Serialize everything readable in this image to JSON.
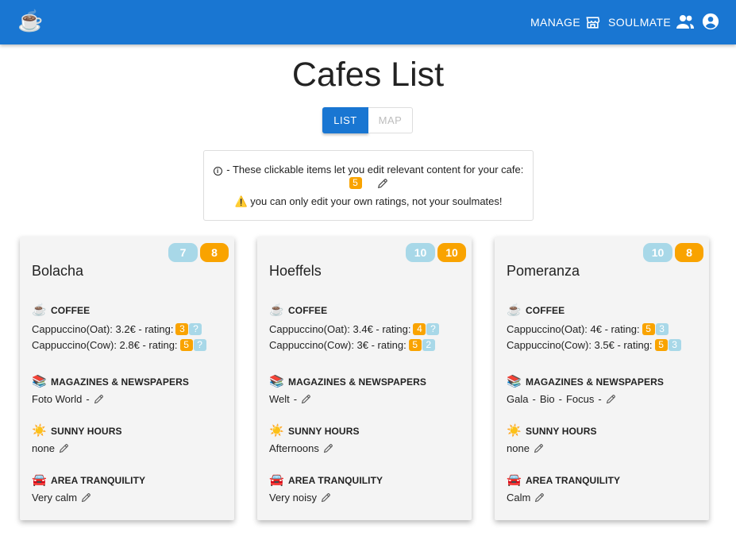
{
  "app": {
    "logo": "☕",
    "nav": {
      "manage": "MANAGE",
      "soulmate": "SOULMATE"
    }
  },
  "page": {
    "title": "Cafes List",
    "toggle": {
      "list": "LIST",
      "map": "MAP",
      "selected": "LIST"
    }
  },
  "info": {
    "line1": "- These clickable items let you edit relevant content for your cafe:",
    "example_badge": "5",
    "line3": "⚠️ you can only edit your own ratings, not your soulmates!"
  },
  "labels": {
    "coffee": "COFFEE",
    "magazines": "MAGAZINES & NEWSPAPERS",
    "sunny": "SUNNY HOURS",
    "tranquility": "AREA TRANQUILITY"
  },
  "icons": {
    "coffee": "☕",
    "magazines": "📚",
    "sunny": "☀️",
    "tranquility": "🚘"
  },
  "colors": {
    "primary": "#1976d2",
    "own_rating": "#f9a300",
    "soulmate_rating": "#a8d8e8"
  },
  "cafes": [
    {
      "name": "Bolacha",
      "soulmate_score": "7",
      "own_score": "8",
      "coffee": [
        {
          "text": "Cappuccino(Oat): 3.2€ - rating:",
          "own": "3",
          "soulmate": "?"
        },
        {
          "text": "Cappuccino(Cow): 2.8€ - rating:",
          "own": "5",
          "soulmate": "?"
        }
      ],
      "magazines": [
        "Foto World",
        "-"
      ],
      "sunny": "none",
      "tranquility": "Very calm"
    },
    {
      "name": "Hoeffels",
      "soulmate_score": "10",
      "own_score": "10",
      "coffee": [
        {
          "text": "Cappuccino(Oat): 3.4€ - rating:",
          "own": "4",
          "soulmate": "?"
        },
        {
          "text": "Cappuccino(Cow): 3€ - rating:",
          "own": "5",
          "soulmate": "2"
        }
      ],
      "magazines": [
        "Welt",
        "-"
      ],
      "sunny": "Afternoons",
      "tranquility": "Very noisy"
    },
    {
      "name": "Pomeranza",
      "soulmate_score": "10",
      "own_score": "8",
      "coffee": [
        {
          "text": "Cappuccino(Oat): 4€ - rating:",
          "own": "5",
          "soulmate": "3"
        },
        {
          "text": "Cappuccino(Cow): 3.5€ - rating:",
          "own": "5",
          "soulmate": "3"
        }
      ],
      "magazines": [
        "Gala",
        "-",
        "Bio",
        "-",
        "Focus",
        "-"
      ],
      "sunny": "none",
      "tranquility": "Calm"
    }
  ]
}
